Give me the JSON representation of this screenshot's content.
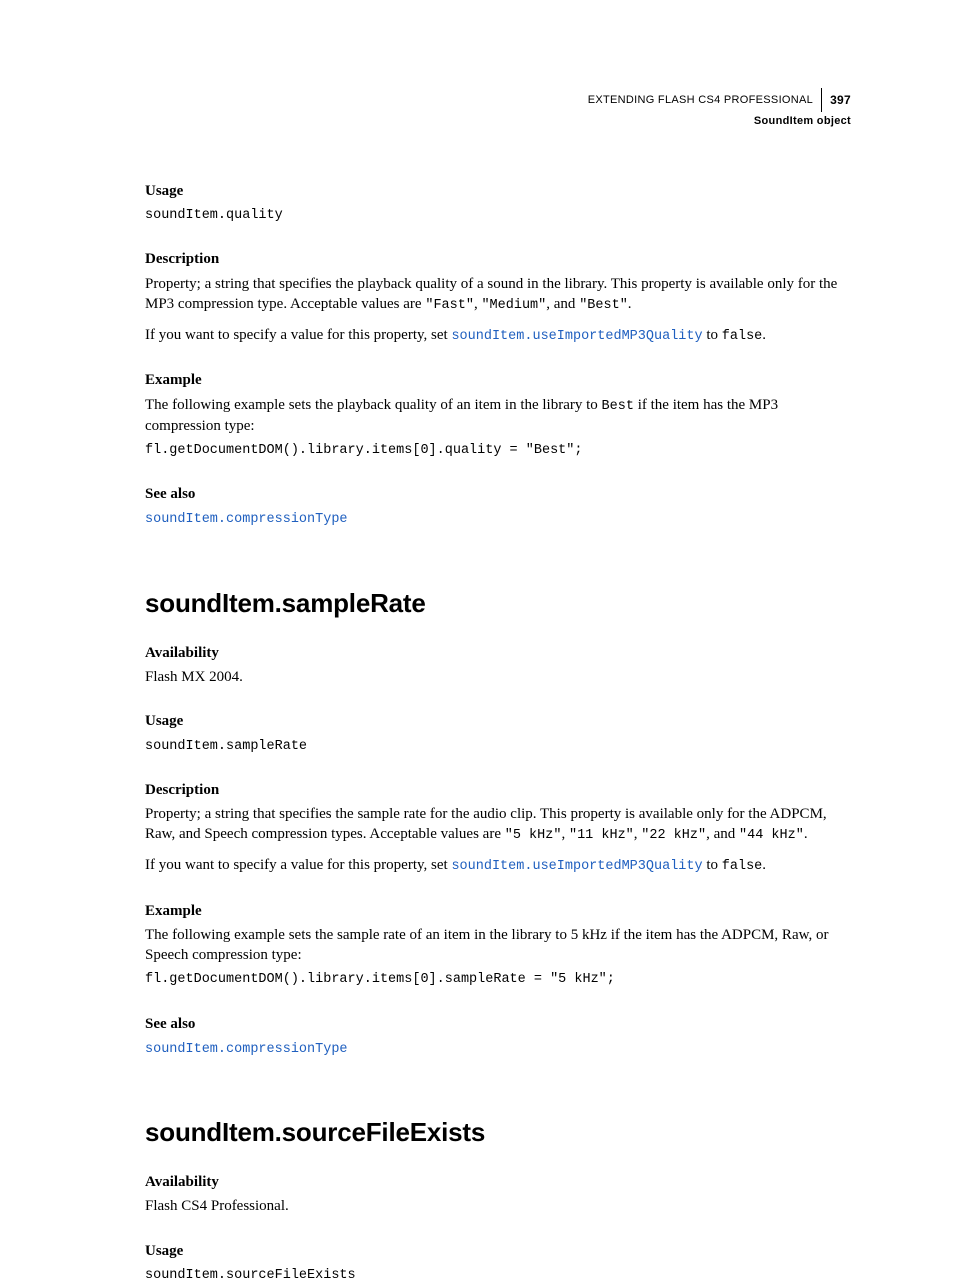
{
  "header": {
    "doc_title": "EXTENDING FLASH CS4 PROFESSIONAL",
    "page_number": "397",
    "section_label": "SoundItem object"
  },
  "sec1": {
    "usage_h": "Usage",
    "usage_code": "soundItem.quality",
    "desc_h": "Description",
    "desc_p1a": "Property; a string that specifies the playback quality of a sound in the library. This property is available only for the MP3 compression type. Acceptable values are ",
    "desc_p1_code1": "\"Fast\"",
    "desc_p1_sep1": ", ",
    "desc_p1_code2": "\"Medium\"",
    "desc_p1_sep2": ", and ",
    "desc_p1_code3": "\"Best\"",
    "desc_p1_end": ".",
    "desc_p2a": "If you want to specify a value for this property, set ",
    "desc_p2_link": "soundItem.useImportedMP3Quality",
    "desc_p2b": " to ",
    "desc_p2_code": "false",
    "desc_p2_end": ".",
    "ex_h": "Example",
    "ex_p1a": "The following example sets the playback quality of an item in the library to ",
    "ex_p1_code": "Best",
    "ex_p1b": " if the item has the MP3 compression type:",
    "ex_code": "fl.getDocumentDOM().library.items[0].quality = \"Best\";",
    "see_h": "See also",
    "see_link": "soundItem.compressionType"
  },
  "sec2": {
    "heading": "soundItem.sampleRate",
    "avail_h": "Availability",
    "avail_p": "Flash MX 2004.",
    "usage_h": "Usage",
    "usage_code": "soundItem.sampleRate",
    "desc_h": "Description",
    "desc_p1a": "Property; a string that specifies the sample rate for the audio clip. This property is available only for the ADPCM, Raw, and Speech compression types. Acceptable values are ",
    "desc_p1_code1": "\"5 kHz\"",
    "desc_p1_sep1": ", ",
    "desc_p1_code2": "\"11 kHz\"",
    "desc_p1_sep2": ", ",
    "desc_p1_code3": "\"22 kHz\"",
    "desc_p1_sep3": ", and ",
    "desc_p1_code4": "\"44 kHz\"",
    "desc_p1_end": ".",
    "desc_p2a": "If you want to specify a value for this property, set ",
    "desc_p2_link": "soundItem.useImportedMP3Quality",
    "desc_p2b": " to ",
    "desc_p2_code": "false",
    "desc_p2_end": ".",
    "ex_h": "Example",
    "ex_p": "The following example sets the sample rate of an item in the library to 5 kHz if the item has the ADPCM, Raw, or Speech compression type:",
    "ex_code": "fl.getDocumentDOM().library.items[0].sampleRate = \"5 kHz\";",
    "see_h": "See also",
    "see_link": "soundItem.compressionType"
  },
  "sec3": {
    "heading": "soundItem.sourceFileExists",
    "avail_h": "Availability",
    "avail_p": "Flash CS4 Professional.",
    "usage_h": "Usage",
    "usage_code": "soundItem.sourceFileExists"
  }
}
